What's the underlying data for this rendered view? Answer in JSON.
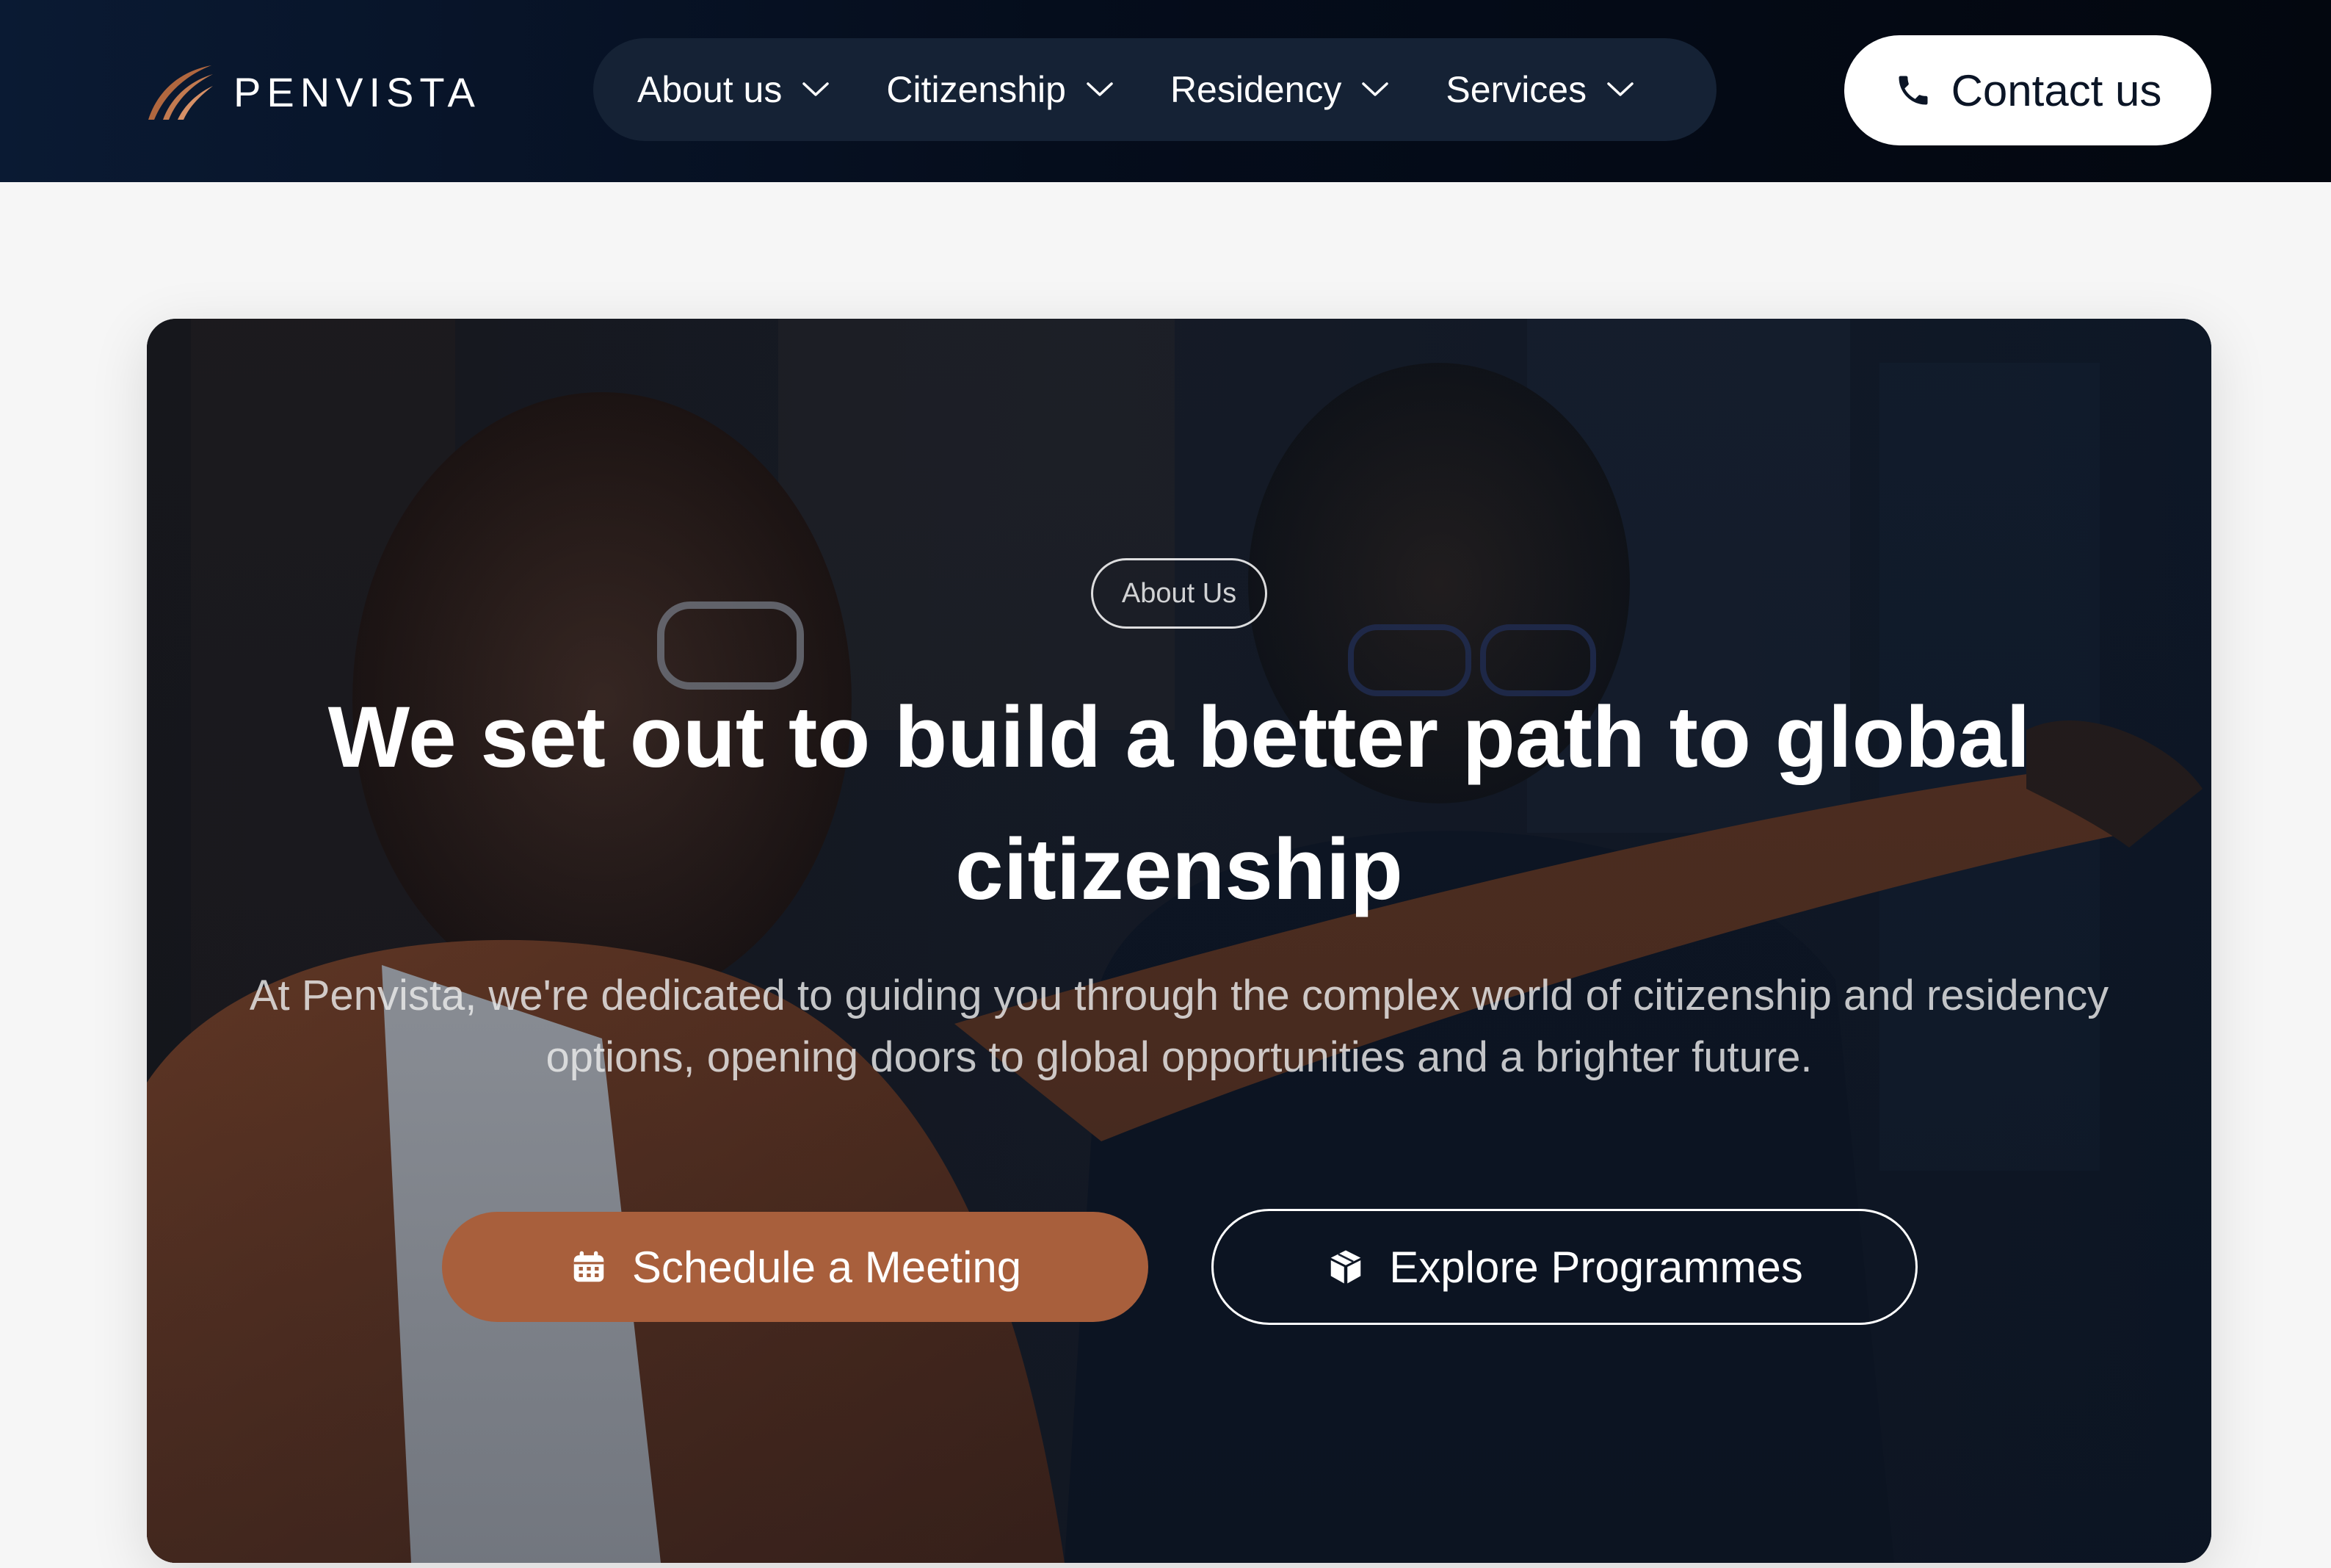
{
  "brand": {
    "name": "PENVISTA",
    "accent_color": "#a85f3c",
    "header_color": "#050d1c"
  },
  "nav": {
    "items": [
      {
        "label": "About us",
        "icon": "chevron-down-icon"
      },
      {
        "label": "Citizenship",
        "icon": "chevron-down-icon"
      },
      {
        "label": "Residency",
        "icon": "chevron-down-icon"
      },
      {
        "label": "Services",
        "icon": "chevron-down-icon"
      }
    ]
  },
  "contact": {
    "label": "Contact us",
    "icon": "phone-icon"
  },
  "hero": {
    "badge": "About Us",
    "headline": "We set out to build a better path to global citizenship",
    "subtext": "At Penvista, we're dedicated to guiding you through the complex world of citizenship and residency options, opening doors to global opportunities and a brighter future.",
    "primary_button": {
      "label": "Schedule a Meeting",
      "icon": "calendar-icon"
    },
    "secondary_button": {
      "label": "Explore Programmes",
      "icon": "box-icon"
    }
  }
}
